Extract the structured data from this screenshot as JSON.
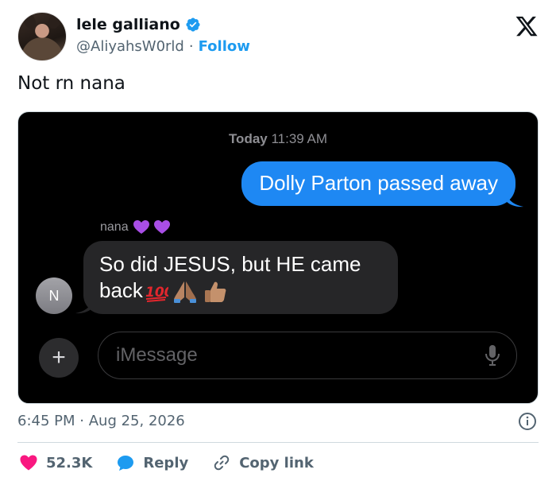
{
  "colors": {
    "accent": "#1d9bf0",
    "like": "#f91880",
    "bubble_out": "#1e88f3",
    "bubble_in": "#262628"
  },
  "author": {
    "display_name": "lele galliano",
    "handle": "@AliyahsW0rld",
    "separator": "·",
    "follow_label": "Follow",
    "verified": true
  },
  "tweet": {
    "text": "Not rn nana"
  },
  "screenshot": {
    "timestamp_day": "Today",
    "timestamp_time": "11:39 AM",
    "outgoing_message": "Dolly Parton passed away",
    "sender_name": "nana",
    "sender_name_emojis": [
      "purple-heart",
      "purple-heart"
    ],
    "incoming_message_line1": "So did JESUS, but HE came",
    "incoming_message_line2": "back",
    "incoming_emojis": [
      "hundred-points",
      "folded-hands",
      "thumbs-up"
    ],
    "contact_initial": "N",
    "input_placeholder": "iMessage",
    "icons": [
      "plus-icon",
      "microphone-icon"
    ]
  },
  "meta": {
    "time": "6:45 PM",
    "separator": "·",
    "date": "Aug 25, 2026"
  },
  "actions": {
    "likes_count": "52.3K",
    "reply_label": "Reply",
    "copy_link_label": "Copy link"
  }
}
